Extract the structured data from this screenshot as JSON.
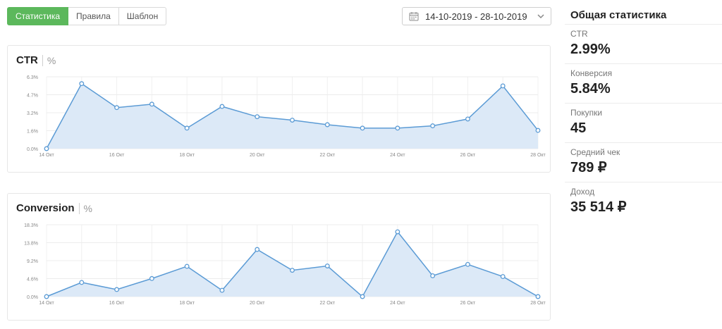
{
  "tabs": [
    {
      "label": "Статистика",
      "active": true
    },
    {
      "label": "Правила",
      "active": false
    },
    {
      "label": "Шаблон",
      "active": false
    }
  ],
  "date_range": {
    "value": "14-10-2019 - 28-10-2019",
    "icon": "calendar-icon",
    "dropdown_icon": "chevron-down-icon"
  },
  "colors": {
    "accent": "#5cb85c",
    "line": "#5b9bd5",
    "fill": "#dce9f7"
  },
  "summary": {
    "title": "Общая статистика",
    "items": [
      {
        "label": "CTR",
        "value": "2.99%"
      },
      {
        "label": "Конверсия",
        "value": "5.84%"
      },
      {
        "label": "Покупки",
        "value": "45"
      },
      {
        "label": "Средний чек",
        "value": "789 ₽"
      },
      {
        "label": "Доход",
        "value": "35 514 ₽"
      }
    ]
  },
  "chart_data": [
    {
      "type": "area",
      "title": "CTR",
      "unit": "%",
      "x": [
        "14 Окт",
        "15 Окт",
        "16 Окт",
        "17 Окт",
        "18 Окт",
        "19 Окт",
        "20 Окт",
        "21 Окт",
        "22 Окт",
        "23 Окт",
        "24 Окт",
        "25 Окт",
        "26 Окт",
        "27 Окт",
        "28 Окт"
      ],
      "xtick_labels": [
        "14 Окт",
        "",
        "16 Окт",
        "",
        "18 Окт",
        "",
        "20 Окт",
        "",
        "22 Окт",
        "",
        "24 Окт",
        "",
        "26 Окт",
        "",
        "28 Окт"
      ],
      "ytick_labels": [
        "0.0%",
        "1.6%",
        "3.2%",
        "4.7%",
        "6.3%"
      ],
      "ylim": [
        0,
        6.3
      ],
      "values": [
        0.0,
        5.7,
        3.6,
        3.9,
        1.8,
        3.7,
        2.8,
        2.5,
        2.1,
        1.8,
        1.8,
        2.0,
        2.6,
        5.5,
        1.6
      ],
      "grid": true
    },
    {
      "type": "area",
      "title": "Conversion",
      "unit": "%",
      "x": [
        "14 Окт",
        "15 Окт",
        "16 Окт",
        "17 Окт",
        "18 Окт",
        "19 Окт",
        "20 Окт",
        "21 Окт",
        "22 Окт",
        "23 Окт",
        "24 Окт",
        "25 Окт",
        "26 Окт",
        "27 Окт",
        "28 Окт"
      ],
      "xtick_labels": [
        "14 Окт",
        "",
        "16 Окт",
        "",
        "18 Окт",
        "",
        "20 Окт",
        "",
        "22 Окт",
        "",
        "24 Окт",
        "",
        "26 Окт",
        "",
        "28 Окт"
      ],
      "ytick_labels": [
        "0.0%",
        "4.6%",
        "9.2%",
        "13.8%",
        "18.3%"
      ],
      "ylim": [
        0,
        18.3
      ],
      "values": [
        0.0,
        3.6,
        1.8,
        4.6,
        7.7,
        1.6,
        12.0,
        6.7,
        7.8,
        0.0,
        16.5,
        5.3,
        8.2,
        5.1,
        0.0
      ],
      "grid": true
    }
  ]
}
